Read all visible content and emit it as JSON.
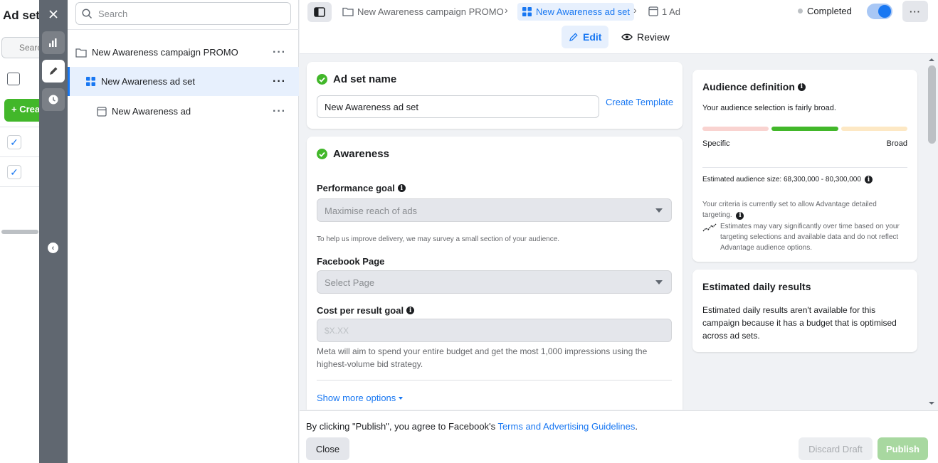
{
  "background": {
    "title": "Ad sets",
    "search_placeholder": "Search",
    "create_label": "+ Create"
  },
  "tree": {
    "search_placeholder": "Search",
    "items": [
      {
        "label": "New Awareness campaign PROMO",
        "icon": "folder-icon"
      },
      {
        "label": "New Awareness ad set",
        "icon": "grid-icon"
      },
      {
        "label": "New Awareness ad",
        "icon": "ad-icon"
      }
    ]
  },
  "header": {
    "breadcrumbs": [
      "New Awareness campaign PROMO",
      "New Awareness ad set",
      "1 Ad"
    ],
    "status": "Completed",
    "tabs": {
      "edit": "Edit",
      "review": "Review"
    }
  },
  "adset_card": {
    "title": "Ad set name",
    "name_value": "New Awareness ad set",
    "create_template": "Create Template"
  },
  "awareness_card": {
    "title": "Awareness",
    "performance_goal_label": "Performance goal",
    "performance_goal_value": "Maximise reach of ads",
    "survey_note": "To help us improve delivery, we may survey a small section of your audience.",
    "facebook_page_label": "Facebook Page",
    "facebook_page_placeholder": "Select Page",
    "cost_goal_label": "Cost per result goal",
    "cost_goal_placeholder": "$X.XX",
    "cost_help": "Meta will aim to spend your entire budget and get the most 1,000 impressions using the highest-volume bid strategy.",
    "show_more": "Show more options"
  },
  "audience": {
    "title": "Audience definition",
    "subtitle": "Your audience selection is fairly broad.",
    "specific_label": "Specific",
    "broad_label": "Broad",
    "estimated_size": "Estimated audience size: 68,300,000 - 80,300,000",
    "criteria_note": "Your criteria is currently set to allow Advantage detailed targeting.",
    "estimates_note": "Estimates may vary significantly over time based on your targeting selections and available data and do not reflect Advantage audience options.",
    "colors": {
      "specific": "#f9d3d0",
      "fair": "#42b72a",
      "broad": "#fde8c4"
    }
  },
  "daily_results": {
    "title": "Estimated daily results",
    "body": "Estimated daily results aren't available for this campaign because it has a budget that is optimised across ad sets."
  },
  "footer": {
    "agree_prefix": "By clicking \"Publish\", you agree to Facebook's ",
    "agree_link": "Terms and Advertising Guidelines",
    "agree_suffix": ".",
    "close_label": "Close",
    "discard_label": "Discard Draft",
    "publish_label": "Publish"
  }
}
